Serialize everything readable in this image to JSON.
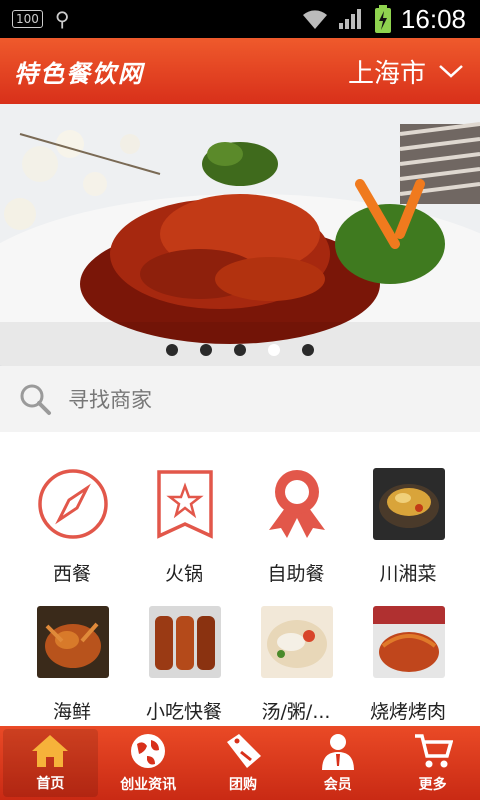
{
  "status_bar": {
    "battery_small_label": "100",
    "time": "16:08"
  },
  "header": {
    "logo_text": "特色餐饮网",
    "city": "上海市"
  },
  "banner": {
    "slides_count": 5,
    "active_index": 3
  },
  "search": {
    "placeholder": "寻找商家"
  },
  "categories": [
    {
      "label": "西餐"
    },
    {
      "label": "火锅"
    },
    {
      "label": "自助餐"
    },
    {
      "label": "川湘菜"
    },
    {
      "label": "海鲜"
    },
    {
      "label": "小吃快餐"
    },
    {
      "label": "汤/粥/..."
    },
    {
      "label": "烧烤烤肉"
    }
  ],
  "bottom_nav": [
    {
      "label": "首页",
      "icon": "home-icon"
    },
    {
      "label": "创业资讯",
      "icon": "globe-icon"
    },
    {
      "label": "团购",
      "icon": "sale-tag-icon"
    },
    {
      "label": "会员",
      "icon": "member-icon"
    },
    {
      "label": "更多",
      "icon": "cart-icon"
    }
  ],
  "colors": {
    "brand_red": "#d8301a",
    "icon_red": "#e2574a"
  }
}
